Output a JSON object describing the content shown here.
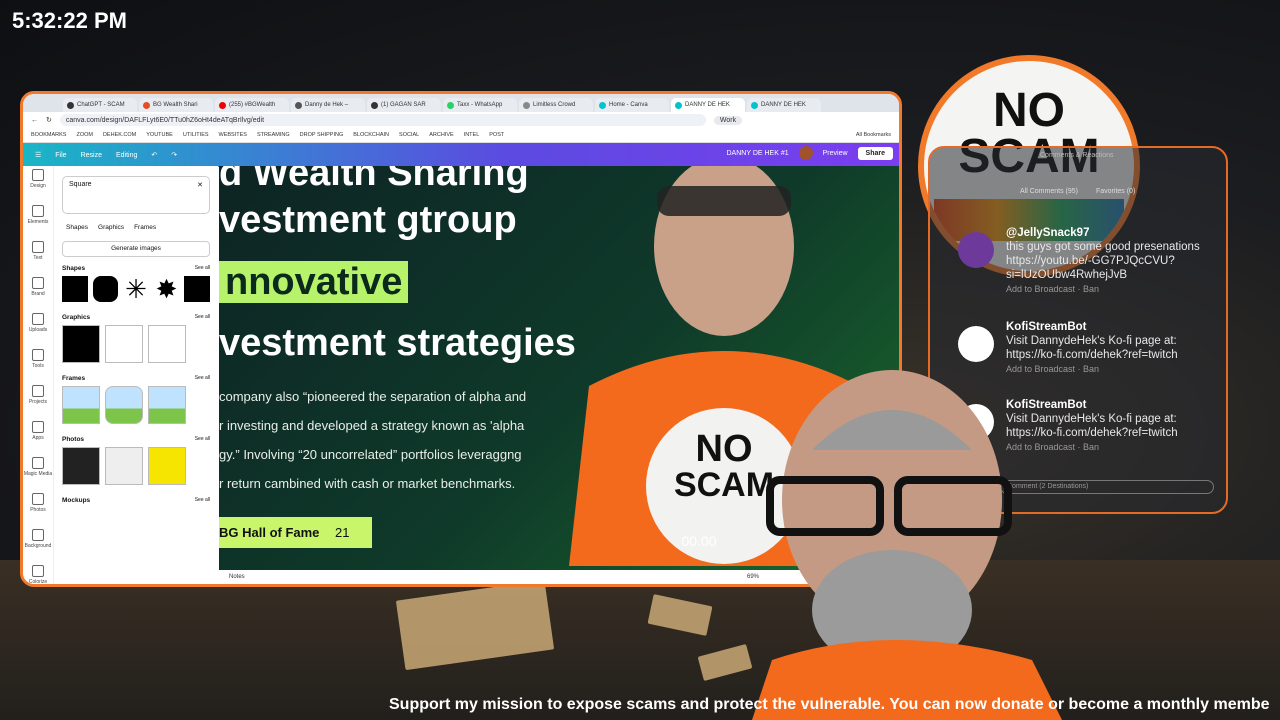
{
  "clock": "5:32:22 PM",
  "browser": {
    "tabs": [
      {
        "label": "ChatGPT - SCAM",
        "color": "#333"
      },
      {
        "label": "BG Wealth Shari",
        "color": "#e34c26"
      },
      {
        "label": "(255) #BGWealth",
        "color": "#e00"
      },
      {
        "label": "Danny de Hek –",
        "color": "#555"
      },
      {
        "label": "(1) GAGAN SAR",
        "color": "#333"
      },
      {
        "label": "Taxx - WhatsApp",
        "color": "#25d366"
      },
      {
        "label": "Limitless Crowd",
        "color": "#888"
      },
      {
        "label": "Home - Canva",
        "color": "#00c4cc"
      },
      {
        "label": "DANNY DE HEK",
        "color": "#00c4cc"
      },
      {
        "label": "DANNY DE HEK",
        "color": "#00c4cc"
      }
    ],
    "url": "canva.com/design/DAFLFLyt6E0/TTu0hZ6oHt4deATqBrIlvg/edit",
    "profile": "Work",
    "bookmarks": [
      "BOOKMARKS",
      "ZOOM",
      "DEHEK.COM",
      "YOUTUBE",
      "UTILITIES",
      "WEBSITES",
      "STREAMING",
      "DROP SHIPPING",
      "BLOCKCHAIN",
      "SOCIAL",
      "ARCHIVE",
      "INTEL",
      "POST"
    ],
    "all_bookmarks": "All Bookmarks"
  },
  "canva": {
    "file": "File",
    "resize": "Resize",
    "editing": "Editing",
    "project": "DANNY DE HEK #1",
    "preview": "Preview",
    "share": "Share",
    "rail": [
      "Design",
      "Elements",
      "Text",
      "Brand",
      "Uploads",
      "Tools",
      "Projects",
      "Apps",
      "Magic Media",
      "Photos",
      "Background",
      "Colorize"
    ],
    "search": "Square",
    "chips": [
      "Shapes",
      "Graphics",
      "Frames"
    ],
    "generate": "Generate images",
    "sections": [
      "Shapes",
      "Graphics",
      "Frames",
      "Photos",
      "Mockups"
    ],
    "see_all": "See all",
    "notes": "Notes",
    "zoom": "69%"
  },
  "slide": {
    "line1": "d Wealth Sharing",
    "line2": "vestment gtroup",
    "line3": "nnovative",
    "line4": "vestment strategies",
    "body1": "company also  “pioneered the separation of alpha and",
    "body2": "r investing and developed a strategy known as 'alpha",
    "body3": "gy.” Involving “20 uncorrelated” portfolios leveraggng",
    "body4": "r return cambined with cash or market benchmarks.",
    "hof": "BG Hall of Fame",
    "hof_num": "21",
    "shirt_no": "NO",
    "shirt_scam": "SCAM",
    "shirt_meter": "00.00"
  },
  "badge": {
    "no": "NO",
    "scam": "SCAM"
  },
  "chat": {
    "header": "Comments & Reactions",
    "all": "All Comments (95)",
    "fav": "Favorites (0)",
    "messages": [
      {
        "user": "@JellySnack97",
        "text": "this guys got some good presenations https://youtu.be/-GG7PJQcCVU?si=lUzOUbw4RwhejJvB",
        "actions": "Add to Broadcast  ·  Ban"
      },
      {
        "user": "KofiStreamBot",
        "text": "Visit DannydeHek's Ko-fi page at: https://ko-fi.com/dehek?ref=twitch",
        "actions": "Add to Broadcast  ·  Ban"
      },
      {
        "user": "KofiStreamBot",
        "text": "Visit DannydeHek's Ko-fi page at: https://ko-fi.com/dehek?ref=twitch",
        "actions": "Add to Broadcast  ·  Ban"
      }
    ],
    "input": "Comment (2 Destinations)"
  },
  "ticker": "Support my mission to expose scams and protect the vulnerable. You can now donate or become a monthly membe"
}
